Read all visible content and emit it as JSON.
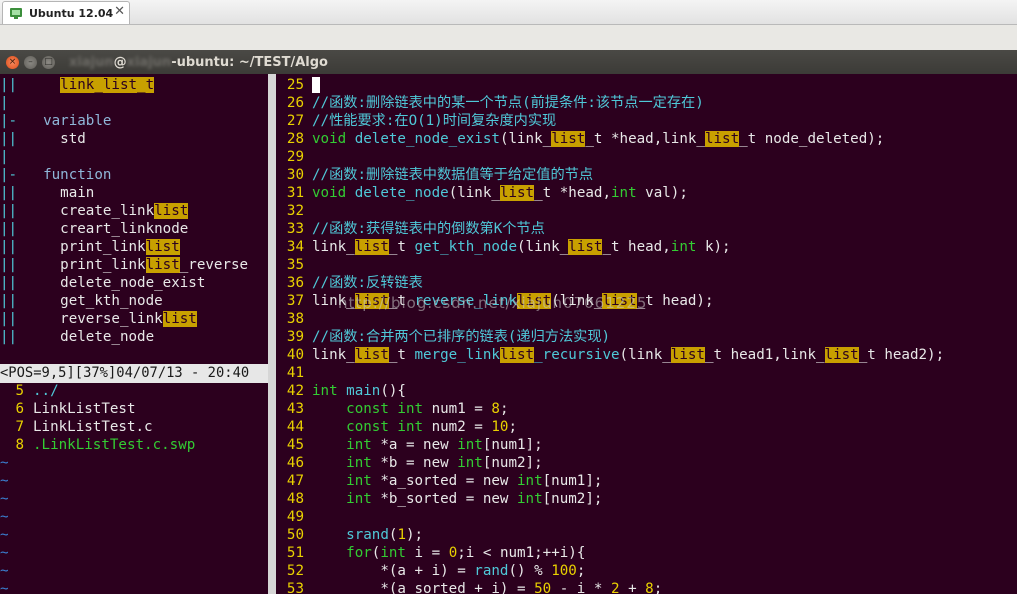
{
  "tab": {
    "title": "Ubuntu 12.04",
    "close_glyph": "✕"
  },
  "window": {
    "title_blur_1": "xiajun",
    "title_at": "@",
    "title_blur_2": "xiajun",
    "title_rest": "-ubuntu: ~/TEST/Algo",
    "close_glyph": "×",
    "min_glyph": "–",
    "max_glyph": "□"
  },
  "left_pane": {
    "tagbar": [
      {
        "gutter": "||",
        "parts": [
          {
            "t": "    ",
            "c": ""
          },
          {
            "t": "link_list_t",
            "c": "hl"
          }
        ]
      },
      {
        "gutter": "|",
        "parts": []
      },
      {
        "gutter": "|-",
        "parts": [
          {
            "t": "  variable",
            "c": "gray-blue"
          }
        ]
      },
      {
        "gutter": "||",
        "parts": [
          {
            "t": "    std",
            "c": "white"
          }
        ]
      },
      {
        "gutter": "|",
        "parts": []
      },
      {
        "gutter": "|-",
        "parts": [
          {
            "t": "  function",
            "c": "gray-blue"
          }
        ]
      },
      {
        "gutter": "||",
        "parts": [
          {
            "t": "    main",
            "c": "white"
          }
        ]
      },
      {
        "gutter": "||",
        "parts": [
          {
            "t": "    create_link",
            "c": "white"
          },
          {
            "t": "list",
            "c": "hl"
          }
        ]
      },
      {
        "gutter": "||",
        "parts": [
          {
            "t": "    creart_linknode",
            "c": "white"
          }
        ]
      },
      {
        "gutter": "||",
        "parts": [
          {
            "t": "    print_link",
            "c": "white"
          },
          {
            "t": "list",
            "c": "hl"
          }
        ]
      },
      {
        "gutter": "||",
        "parts": [
          {
            "t": "    print_link",
            "c": "white"
          },
          {
            "t": "list",
            "c": "hl"
          },
          {
            "t": "_reverse",
            "c": "white"
          }
        ]
      },
      {
        "gutter": "||",
        "parts": [
          {
            "t": "    delete_node_exist",
            "c": "white"
          }
        ]
      },
      {
        "gutter": "||",
        "parts": [
          {
            "t": "    get_kth_node",
            "c": "white"
          }
        ]
      },
      {
        "gutter": "||",
        "parts": [
          {
            "t": "    reverse_link",
            "c": "white"
          },
          {
            "t": "list",
            "c": "hl"
          }
        ]
      },
      {
        "gutter": "||",
        "parts": [
          {
            "t": "    delete_node",
            "c": "white"
          }
        ]
      }
    ],
    "status": "<POS=9,5][37%]04/07/13 - 20:40",
    "files": [
      {
        "num": "5",
        "name": "../",
        "c": "cyan"
      },
      {
        "num": "6",
        "name": "LinkListTest",
        "c": "white"
      },
      {
        "num": "7",
        "name": "LinkListTest.c",
        "c": "white"
      },
      {
        "num": "8",
        "name": ".LinkListTest.c.swp",
        "c": "green"
      }
    ],
    "tilde": "~"
  },
  "right_pane": {
    "lines": [
      {
        "n": "25",
        "cursor": true,
        "parts": []
      },
      {
        "n": "26",
        "parts": [
          {
            "t": "//函数:删除链表中的某一个节点(前提条件:该节点一定存在)",
            "c": "cyan"
          }
        ]
      },
      {
        "n": "27",
        "parts": [
          {
            "t": "//性能要求:在O(1)时间复杂度内实现",
            "c": "cyan"
          }
        ]
      },
      {
        "n": "28",
        "parts": [
          {
            "t": "void ",
            "c": "green"
          },
          {
            "t": "delete_node_exist",
            "c": "cyan"
          },
          {
            "t": "(link_",
            "c": "white"
          },
          {
            "t": "list",
            "c": "hl"
          },
          {
            "t": "_t *head,link_",
            "c": "white"
          },
          {
            "t": "list",
            "c": "hl"
          },
          {
            "t": "_t node_deleted);",
            "c": "white"
          }
        ]
      },
      {
        "n": "29",
        "parts": []
      },
      {
        "n": "30",
        "parts": [
          {
            "t": "//函数:删除链表中数据值等于给定值的节点",
            "c": "cyan"
          }
        ]
      },
      {
        "n": "31",
        "parts": [
          {
            "t": "void ",
            "c": "green"
          },
          {
            "t": "delete_node",
            "c": "cyan"
          },
          {
            "t": "(link_",
            "c": "white"
          },
          {
            "t": "list",
            "c": "hl"
          },
          {
            "t": "_t *head,",
            "c": "white"
          },
          {
            "t": "int",
            "c": "green"
          },
          {
            "t": " val);",
            "c": "white"
          }
        ]
      },
      {
        "n": "32",
        "parts": []
      },
      {
        "n": "33",
        "parts": [
          {
            "t": "//函数:获得链表中的倒数第K个节点",
            "c": "cyan"
          }
        ]
      },
      {
        "n": "34",
        "parts": [
          {
            "t": "link_",
            "c": "white"
          },
          {
            "t": "list",
            "c": "hl"
          },
          {
            "t": "_t ",
            "c": "white"
          },
          {
            "t": "get_kth_node",
            "c": "cyan"
          },
          {
            "t": "(link_",
            "c": "white"
          },
          {
            "t": "list",
            "c": "hl"
          },
          {
            "t": "_t head,",
            "c": "white"
          },
          {
            "t": "int",
            "c": "green"
          },
          {
            "t": " k);",
            "c": "white"
          }
        ]
      },
      {
        "n": "35",
        "parts": []
      },
      {
        "n": "36",
        "parts": [
          {
            "t": "//函数:反转链表",
            "c": "cyan"
          }
        ]
      },
      {
        "n": "37",
        "parts": [
          {
            "t": "link_",
            "c": "white"
          },
          {
            "t": "list",
            "c": "hl"
          },
          {
            "t": "_t ",
            "c": "white"
          },
          {
            "t": "reverse_link",
            "c": "cyan"
          },
          {
            "t": "list",
            "c": "hl"
          },
          {
            "t": "(link_",
            "c": "white"
          },
          {
            "t": "list",
            "c": "hl"
          },
          {
            "t": "_t head);",
            "c": "white"
          }
        ]
      },
      {
        "n": "38",
        "parts": []
      },
      {
        "n": "39",
        "parts": [
          {
            "t": "//函数:合并两个已排序的链表(递归方法实现)",
            "c": "cyan"
          }
        ]
      },
      {
        "n": "40",
        "parts": [
          {
            "t": "link_",
            "c": "white"
          },
          {
            "t": "list",
            "c": "hl"
          },
          {
            "t": "_t ",
            "c": "white"
          },
          {
            "t": "merge_link",
            "c": "cyan"
          },
          {
            "t": "list",
            "c": "hl"
          },
          {
            "t": "_recursive",
            "c": "cyan"
          },
          {
            "t": "(link_",
            "c": "white"
          },
          {
            "t": "list",
            "c": "hl"
          },
          {
            "t": "_t head1,link_",
            "c": "white"
          },
          {
            "t": "list",
            "c": "hl"
          },
          {
            "t": "_t head2);",
            "c": "white"
          }
        ]
      },
      {
        "n": "41",
        "parts": []
      },
      {
        "n": "42",
        "parts": [
          {
            "t": "int ",
            "c": "green"
          },
          {
            "t": "main",
            "c": "cyan"
          },
          {
            "t": "(){",
            "c": "white"
          }
        ]
      },
      {
        "n": "43",
        "parts": [
          {
            "t": "    ",
            "c": "white"
          },
          {
            "t": "const int",
            "c": "green"
          },
          {
            "t": " num1 = ",
            "c": "white"
          },
          {
            "t": "8",
            "c": "yellow"
          },
          {
            "t": ";",
            "c": "white"
          }
        ]
      },
      {
        "n": "44",
        "parts": [
          {
            "t": "    ",
            "c": "white"
          },
          {
            "t": "const int",
            "c": "green"
          },
          {
            "t": " num2 = ",
            "c": "white"
          },
          {
            "t": "10",
            "c": "yellow"
          },
          {
            "t": ";",
            "c": "white"
          }
        ]
      },
      {
        "n": "45",
        "parts": [
          {
            "t": "    ",
            "c": "white"
          },
          {
            "t": "int",
            "c": "green"
          },
          {
            "t": " *a = new ",
            "c": "white"
          },
          {
            "t": "int",
            "c": "green"
          },
          {
            "t": "[num1];",
            "c": "white"
          }
        ]
      },
      {
        "n": "46",
        "parts": [
          {
            "t": "    ",
            "c": "white"
          },
          {
            "t": "int",
            "c": "green"
          },
          {
            "t": " *b = new ",
            "c": "white"
          },
          {
            "t": "int",
            "c": "green"
          },
          {
            "t": "[num2];",
            "c": "white"
          }
        ]
      },
      {
        "n": "47",
        "parts": [
          {
            "t": "    ",
            "c": "white"
          },
          {
            "t": "int",
            "c": "green"
          },
          {
            "t": " *a_sorted = new ",
            "c": "white"
          },
          {
            "t": "int",
            "c": "green"
          },
          {
            "t": "[num1];",
            "c": "white"
          }
        ]
      },
      {
        "n": "48",
        "parts": [
          {
            "t": "    ",
            "c": "white"
          },
          {
            "t": "int",
            "c": "green"
          },
          {
            "t": " *b_sorted = new ",
            "c": "white"
          },
          {
            "t": "int",
            "c": "green"
          },
          {
            "t": "[num2];",
            "c": "white"
          }
        ]
      },
      {
        "n": "49",
        "parts": []
      },
      {
        "n": "50",
        "parts": [
          {
            "t": "    ",
            "c": "white"
          },
          {
            "t": "srand",
            "c": "cyan"
          },
          {
            "t": "(",
            "c": "white"
          },
          {
            "t": "1",
            "c": "yellow"
          },
          {
            "t": ");",
            "c": "white"
          }
        ]
      },
      {
        "n": "51",
        "parts": [
          {
            "t": "    ",
            "c": "white"
          },
          {
            "t": "for",
            "c": "green"
          },
          {
            "t": "(",
            "c": "white"
          },
          {
            "t": "int",
            "c": "green"
          },
          {
            "t": " i = ",
            "c": "white"
          },
          {
            "t": "0",
            "c": "yellow"
          },
          {
            "t": ";i < num1;++i){",
            "c": "white"
          }
        ]
      },
      {
        "n": "52",
        "parts": [
          {
            "t": "        *(a + i) = ",
            "c": "white"
          },
          {
            "t": "rand",
            "c": "cyan"
          },
          {
            "t": "() % ",
            "c": "white"
          },
          {
            "t": "100",
            "c": "yellow"
          },
          {
            "t": ";",
            "c": "white"
          }
        ]
      },
      {
        "n": "53",
        "parts": [
          {
            "t": "        *(a_sorted + i) = ",
            "c": "white"
          },
          {
            "t": "50",
            "c": "yellow"
          },
          {
            "t": " - i * ",
            "c": "white"
          },
          {
            "t": "2",
            "c": "yellow"
          },
          {
            "t": " + ",
            "c": "white"
          },
          {
            "t": "8",
            "c": "yellow"
          },
          {
            "t": ";",
            "c": "white"
          }
        ]
      }
    ],
    "watermark": "http://blog.csdn.net/xiajun07061225"
  },
  "colors": {
    "terminal_bg": "#2c001e",
    "highlight": "#c8a000",
    "comment_cyan": "#4fc8d8",
    "type_green": "#33cc33",
    "number_yellow": "#e9d100"
  }
}
